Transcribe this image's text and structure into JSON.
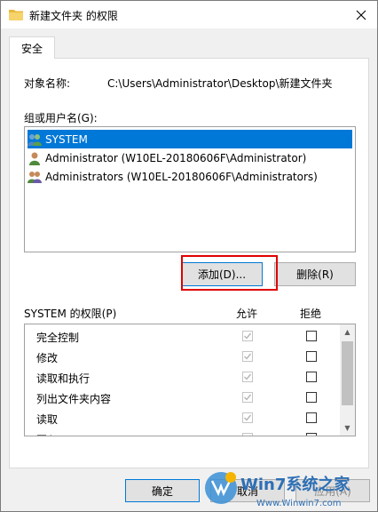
{
  "window": {
    "title": "新建文件夹 的权限",
    "close_icon": "close-icon"
  },
  "tab": {
    "label": "安全"
  },
  "object": {
    "label": "对象名称:",
    "value": "C:\\Users\\Administrator\\Desktop\\新建文件夹"
  },
  "groups": {
    "label": "组或用户名(G):",
    "items": [
      {
        "name": "SYSTEM",
        "icon": "group-users-icon",
        "selected": true
      },
      {
        "name": "Administrator (W10EL-20180606F\\Administrator)",
        "icon": "user-icon",
        "selected": false
      },
      {
        "name": "Administrators (W10EL-20180606F\\Administrators)",
        "icon": "group-users-icon",
        "selected": false
      }
    ]
  },
  "buttons": {
    "add": "添加(D)...",
    "remove": "删除(R)"
  },
  "permissions": {
    "title": "SYSTEM 的权限(P)",
    "allow_header": "允许",
    "deny_header": "拒绝",
    "rows": [
      {
        "name": "完全控制",
        "allow": true,
        "deny": false
      },
      {
        "name": "修改",
        "allow": true,
        "deny": false
      },
      {
        "name": "读取和执行",
        "allow": true,
        "deny": false
      },
      {
        "name": "列出文件夹内容",
        "allow": true,
        "deny": false
      },
      {
        "name": "读取",
        "allow": true,
        "deny": false
      },
      {
        "name": "写入",
        "allow": true,
        "deny": false
      }
    ]
  },
  "footer": {
    "ok": "确定",
    "cancel": "取消",
    "apply": "应用(A)"
  },
  "watermark": {
    "brand": "Win7系统之家",
    "url": "Www.Winwin7.com"
  },
  "colors": {
    "selection": "#0078d7",
    "highlight": "#e00000"
  }
}
